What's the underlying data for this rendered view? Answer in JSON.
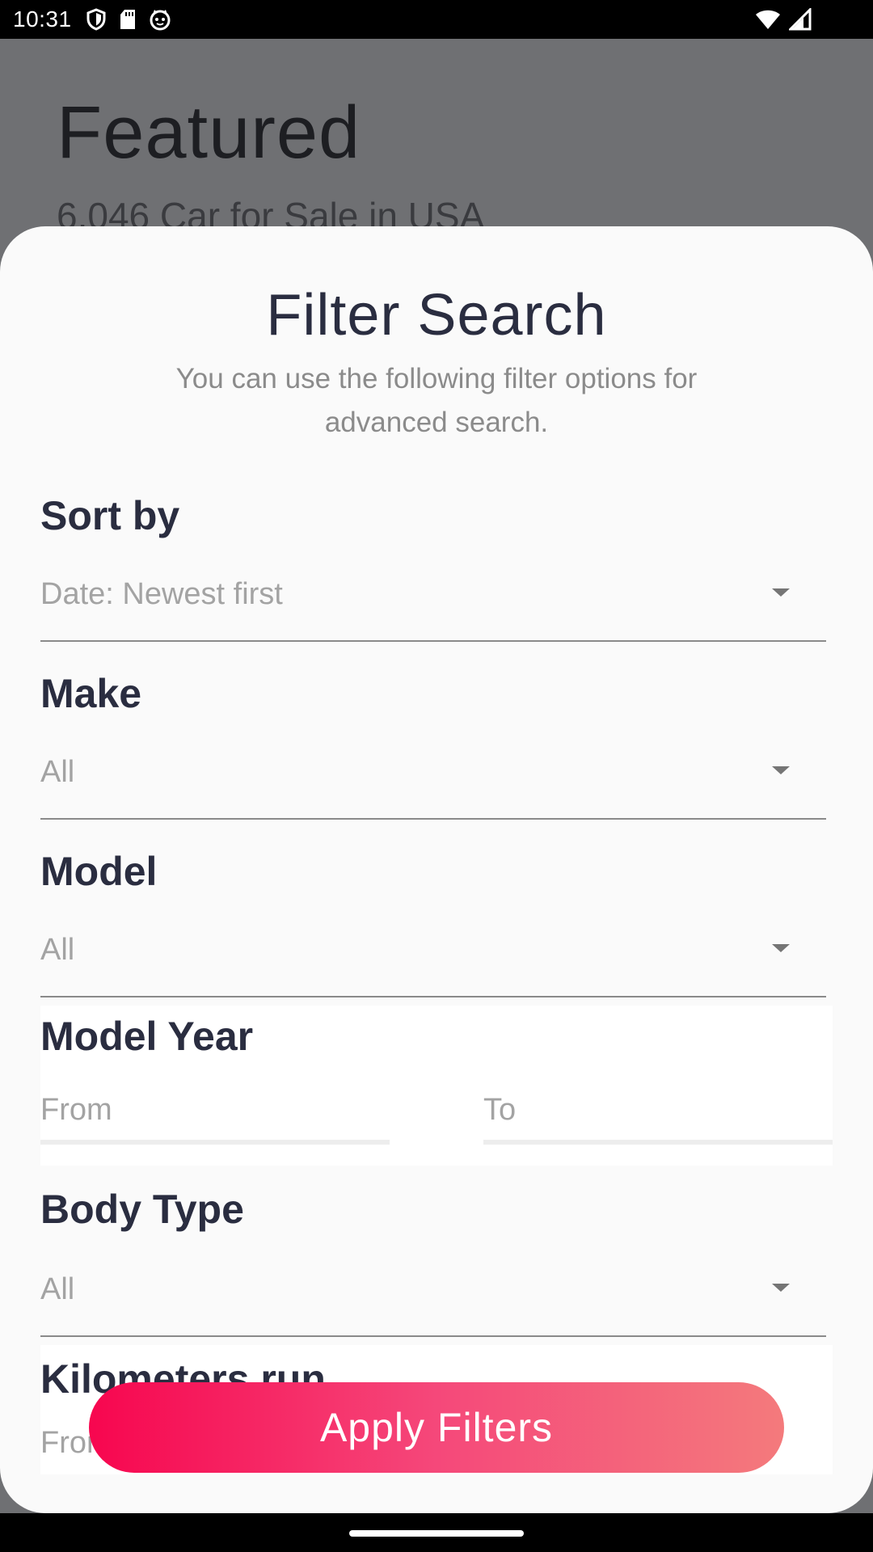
{
  "status_bar": {
    "time": "10:31",
    "left_icons": [
      "shield-icon",
      "sd-card-icon",
      "cat-face-icon"
    ],
    "right_icons": [
      "wifi-icon",
      "cellular-signal-icon"
    ]
  },
  "background_page": {
    "title": "Featured",
    "subtitle": "6,046 Car for Sale in USA"
  },
  "filter_sheet": {
    "title": "Filter Search",
    "description": "You can use the following filter options for advanced search.",
    "sort_by": {
      "label": "Sort by",
      "value": "Date: Newest first"
    },
    "make": {
      "label": "Make",
      "value": "All"
    },
    "model": {
      "label": "Model",
      "value": "All"
    },
    "model_year": {
      "label": "Model Year",
      "from_placeholder": "From",
      "to_placeholder": "To"
    },
    "body_type": {
      "label": "Body Type",
      "value": "All"
    },
    "kilometers_run": {
      "label": "Kilometers run",
      "from_placeholder": "From"
    },
    "apply_button": "Apply Filters",
    "colors": {
      "heading": "#2a2d40",
      "placeholder": "#a3a3a3",
      "button_gradient_start": "#f7064f",
      "button_gradient_end": "#f47a7c"
    }
  }
}
